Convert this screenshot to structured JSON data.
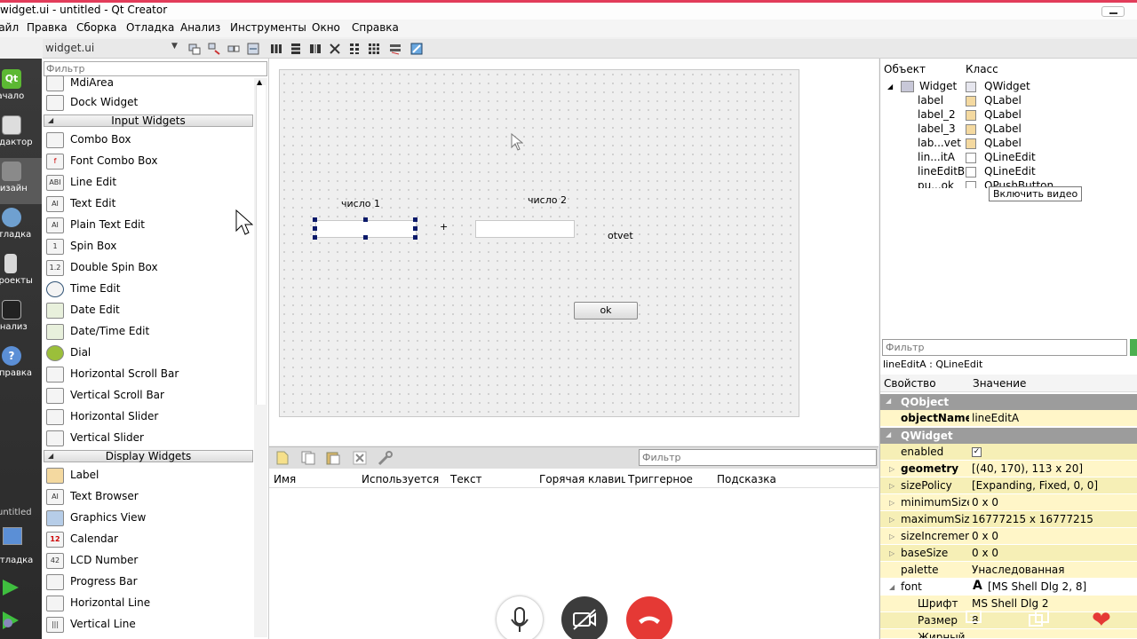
{
  "window": {
    "title": "widget.ui - untitled - Qt Creator"
  },
  "menu": [
    "Файл",
    "Правка",
    "Сборка",
    "Отладка",
    "Анализ",
    "Инструменты",
    "Окно",
    "Справка"
  ],
  "toolbar": {
    "filename": "widget.ui"
  },
  "modes": [
    "Начало",
    "Редактор",
    "Дизайн",
    "Отладка",
    "Проекты",
    "Анализ",
    "Справка"
  ],
  "kit": {
    "project": "untitled",
    "label": "Отладка"
  },
  "widget_box": {
    "filter_placeholder": "Фильтр",
    "items_top": [
      {
        "label": "MdiArea",
        "icon": "mdi-area-icon"
      },
      {
        "label": "Dock Widget",
        "icon": "dock-widget-icon"
      }
    ],
    "input_category": "Input Widgets",
    "input_items": [
      {
        "label": "Combo Box",
        "icon": "combo-box-icon"
      },
      {
        "label": "Font Combo Box",
        "icon": "font-combo-box-icon"
      },
      {
        "label": "Line Edit",
        "icon": "line-edit-icon"
      },
      {
        "label": "Text Edit",
        "icon": "text-edit-icon"
      },
      {
        "label": "Plain Text Edit",
        "icon": "plain-text-edit-icon"
      },
      {
        "label": "Spin Box",
        "icon": "spin-box-icon"
      },
      {
        "label": "Double Spin Box",
        "icon": "double-spin-box-icon"
      },
      {
        "label": "Time Edit",
        "icon": "time-edit-icon"
      },
      {
        "label": "Date Edit",
        "icon": "date-edit-icon"
      },
      {
        "label": "Date/Time Edit",
        "icon": "date-time-edit-icon"
      },
      {
        "label": "Dial",
        "icon": "dial-icon"
      },
      {
        "label": "Horizontal Scroll Bar",
        "icon": "horizontal-scroll-bar-icon"
      },
      {
        "label": "Vertical Scroll Bar",
        "icon": "vertical-scroll-bar-icon"
      },
      {
        "label": "Horizontal Slider",
        "icon": "horizontal-slider-icon"
      },
      {
        "label": "Vertical Slider",
        "icon": "vertical-slider-icon"
      }
    ],
    "display_category": "Display Widgets",
    "display_items": [
      {
        "label": "Label",
        "icon": "label-icon"
      },
      {
        "label": "Text Browser",
        "icon": "text-browser-icon"
      },
      {
        "label": "Graphics View",
        "icon": "graphics-view-icon"
      },
      {
        "label": "Calendar",
        "icon": "calendar-icon"
      },
      {
        "label": "LCD Number",
        "icon": "lcd-number-icon"
      },
      {
        "label": "Progress Bar",
        "icon": "progress-bar-icon"
      },
      {
        "label": "Horizontal Line",
        "icon": "horizontal-line-icon"
      },
      {
        "label": "Vertical Line",
        "icon": "vertical-line-icon"
      }
    ]
  },
  "form": {
    "label1": "число 1",
    "label2": "число 2",
    "plus": "+",
    "answer": "otvet",
    "ok_button": "ok"
  },
  "action_editor": {
    "filter_placeholder": "Фильтр",
    "columns": [
      "Имя",
      "Используется",
      "Текст",
      "Горячая клавиша",
      "Триггерное",
      "Подсказка"
    ]
  },
  "object_inspector": {
    "col_object": "Объект",
    "col_class": "Класс",
    "rows": [
      {
        "name": "Widget",
        "class": "QWidget"
      },
      {
        "name": "label",
        "class": "QLabel"
      },
      {
        "name": "label_2",
        "class": "QLabel"
      },
      {
        "name": "label_3",
        "class": "QLabel"
      },
      {
        "name": "lab...vet",
        "class": "QLabel"
      },
      {
        "name": "lin...itA",
        "class": "QLineEdit"
      },
      {
        "name": "lineEditB",
        "class": "QLineEdit"
      },
      {
        "name": "pu...ok",
        "class": "QPushButton"
      }
    ],
    "tooltip": "Включить видео"
  },
  "property_editor": {
    "filter_placeholder": "Фильтр",
    "current": "lineEditA : QLineEdit",
    "col_property": "Свойство",
    "col_value": "Значение",
    "group_qobject": "QObject",
    "group_qwidget": "QWidget",
    "props": {
      "objectName": {
        "name": "objectName",
        "value": "lineEditA"
      },
      "enabled": {
        "name": "enabled",
        "value": "✓"
      },
      "geometry": {
        "name": "geometry",
        "value": "[(40, 170), 113 x 20]"
      },
      "sizePolicy": {
        "name": "sizePolicy",
        "value": "[Expanding, Fixed, 0, 0]"
      },
      "minimumSize": {
        "name": "minimumSize",
        "value": "0 x 0"
      },
      "maximumSize": {
        "name": "maximumSize",
        "value": "16777215 x 16777215"
      },
      "sizeIncrement": {
        "name": "sizeIncrement",
        "value": "0 x 0"
      },
      "baseSize": {
        "name": "baseSize",
        "value": "0 x 0"
      },
      "palette": {
        "name": "palette",
        "value": "Унаследованная"
      },
      "font": {
        "name": "font",
        "value": "[MS Shell Dlg 2, 8]"
      },
      "font_family": {
        "name": "Шрифт",
        "value": "MS Shell Dlg 2"
      },
      "font_size": {
        "name": "Размер",
        "value": "8"
      },
      "font_bold": {
        "name": "Жирный",
        "value": ""
      }
    }
  },
  "colors": {
    "accent": "#e23c5a",
    "group": "#9c9c9c",
    "prop_bg": "#fff6c8",
    "hangup": "#e53935"
  }
}
